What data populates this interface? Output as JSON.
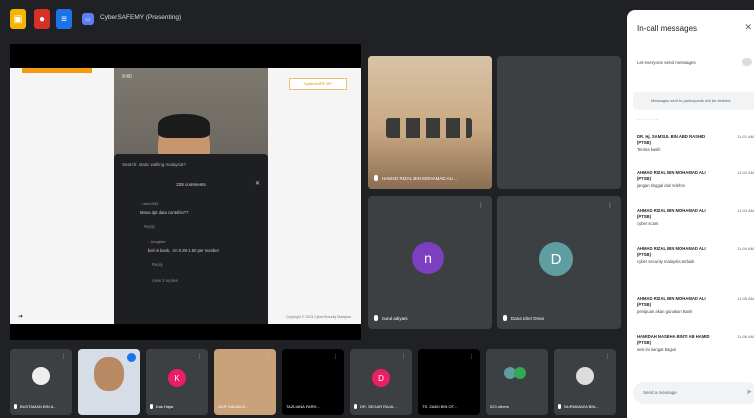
{
  "topbar": {
    "title": "CyberSAFEMY (Presenting)"
  },
  "slide": {
    "logo_text": "CyberSAFE MY",
    "phone_status": "9:40",
    "chat_prompt": "Search: static walling malaysia?",
    "comments_count": "228 comments",
    "comments": [
      {
        "user": "··user1083",
        "text": "Mana dpt data contohin??"
      },
      {
        "user": "",
        "text": "Reply"
      },
      {
        "user": "··Jangkike",
        "text": "beli ni bank.. rm 0.28-1.50 per number"
      },
      {
        "user": "",
        "text": "Reply"
      },
      {
        "user": "",
        "text": "View 3 replies"
      }
    ],
    "footer": "Copyright © 2023 CyberSecurity Malaysia"
  },
  "tiles": [
    {
      "name": "HAMAD RIZAL BIN MOHAMAD ALI...",
      "initial": ""
    },
    {
      "name": "nurul adiyani",
      "initial": "n"
    },
    {
      "name": "Dana Idrel Omar",
      "initial": "D"
    }
  ],
  "strip": [
    {
      "name": "BUSTAMAN BIN A...",
      "initial": ""
    },
    {
      "name": "",
      "initial": ""
    },
    {
      "name": "Kak Hajar",
      "initial": "K"
    },
    {
      "name": "NUR SALWA B...",
      "initial": ""
    },
    {
      "name": "TAZLIANA FARH...",
      "initial": ""
    },
    {
      "name": "DR. SEGAR RAJA...",
      "initial": "D"
    },
    {
      "name": "TS. ZAIDI BIN OT...",
      "initial": ""
    },
    {
      "name": "523 others",
      "initial": ""
    },
    {
      "name": "NURMANIZA BIN...",
      "initial": ""
    }
  ],
  "panel": {
    "title": "In-call messages",
    "toggle_label": "Let everyone send messages",
    "banner": "Messages sent to participants will be deleted",
    "cut_text": "... ... ... ... ...",
    "messages": [
      {
        "sender": "DR. Hj. SAMSUL BIN ABD RASHID (PTSB)",
        "time": "11:01 AM",
        "text": "Terima kasih"
      },
      {
        "sender": "AHMAD RIZAL BIN MOHAMAD ALI (PTSB)",
        "time": "11:02 AM",
        "text": "jangan tinggal dari telefon"
      },
      {
        "sender": "AHMAD RIZAL BIN MOHAMAD ALI (PTSB)",
        "time": "11:03 AM",
        "text": "cyber scam"
      },
      {
        "sender": "AHMAD RIZAL BIN MOHAMAD ALI (PTSB)",
        "time": "11:04 AM",
        "text": "cyber security malaysia terbaik"
      },
      {
        "sender": "AHMAD RIZAL BIN MOHAMAD ALI (PTSB)",
        "time": "11:05 AM",
        "text": "penipuan akan gunakan Bank"
      },
      {
        "sender": "HAMIDAH NASEHA BINTI AB HAMID (PTSB)",
        "time": "11:06 AM",
        "text": "sesi ini sangat bagus"
      }
    ],
    "input_placeholder": "Send a message"
  },
  "colors": {
    "accent": "#f39c12",
    "avatar_purple": "#7b3fbf",
    "avatar_teal": "#5f9ea0",
    "avatar_pink": "#e91e63"
  }
}
